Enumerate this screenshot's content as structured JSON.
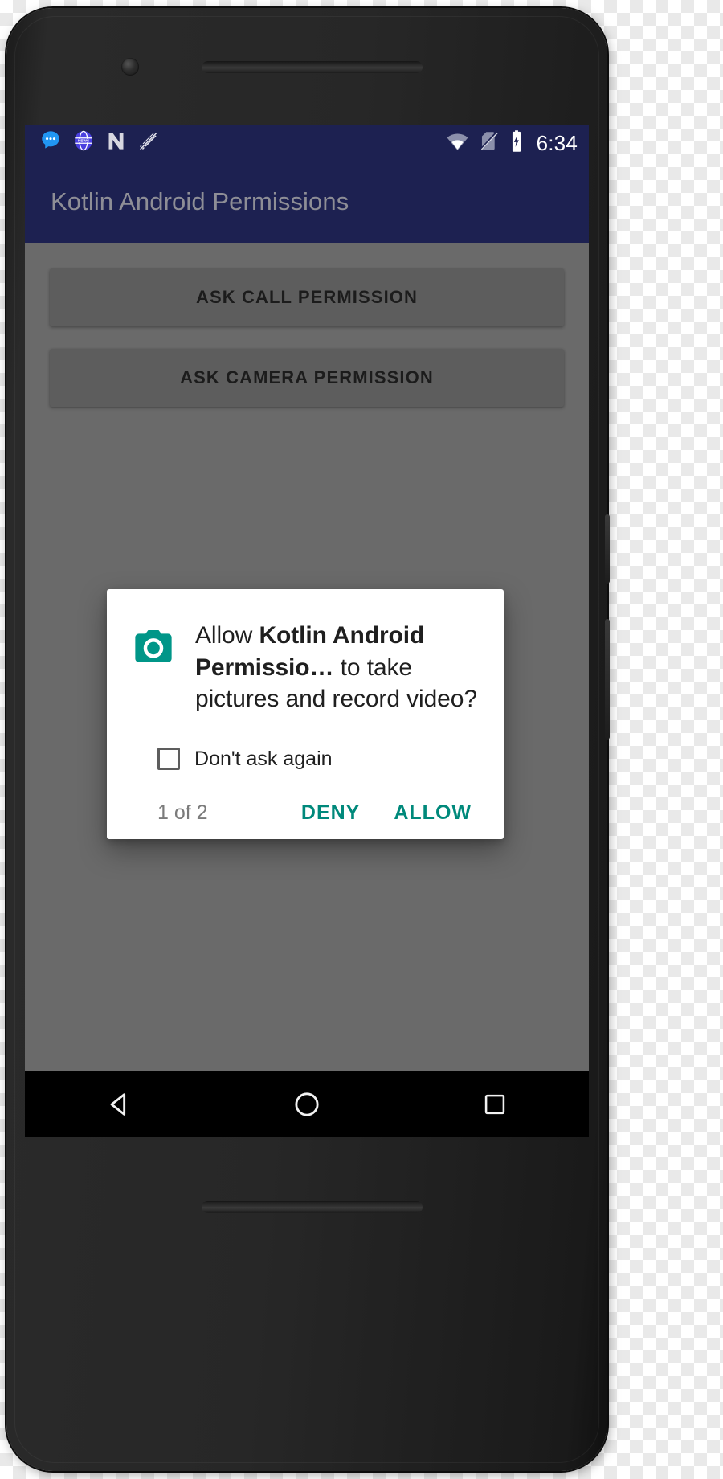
{
  "device": {
    "frame_color": "#242424",
    "screen_bg": "#6a6a6a"
  },
  "statusbar": {
    "background": "#1d2151",
    "time": "6:34",
    "left_icons": [
      {
        "name": "messages-icon",
        "label": "Messages"
      },
      {
        "name": "news-icon",
        "label": "News"
      },
      {
        "name": "nova-launcher-icon",
        "label": "N"
      },
      {
        "name": "ringer-silent-icon",
        "label": "Silent mode"
      }
    ],
    "right_icons": [
      {
        "name": "wifi-icon",
        "label": "Wi-Fi"
      },
      {
        "name": "no-sim-icon",
        "label": "No SIM"
      },
      {
        "name": "battery-charging-icon",
        "label": "Battery charging"
      }
    ]
  },
  "appbar": {
    "title": "Kotlin Android Permissions",
    "background": "#1d2151",
    "title_color": "#8e8e96"
  },
  "main": {
    "buttons": [
      {
        "label": "ASK CALL PERMISSION",
        "name": "ask-call-permission-button"
      },
      {
        "label": "ASK CAMERA PERMISSION",
        "name": "ask-camera-permission-button"
      }
    ]
  },
  "dialog": {
    "icon": "camera-icon",
    "icon_color": "#009688",
    "message_prefix": "Allow ",
    "message_app": "Kotlin Android Permissio…",
    "message_suffix": " to take pictures and record video?",
    "checkbox": {
      "label": "Don't ask again",
      "checked": false
    },
    "counter": "1 of 2",
    "deny_label": "DENY",
    "allow_label": "ALLOW",
    "action_color": "#00897b"
  },
  "navbar": {
    "background": "#000000",
    "items": [
      {
        "name": "nav-back-icon",
        "label": "Back"
      },
      {
        "name": "nav-home-icon",
        "label": "Home"
      },
      {
        "name": "nav-recents-icon",
        "label": "Recents"
      }
    ]
  }
}
